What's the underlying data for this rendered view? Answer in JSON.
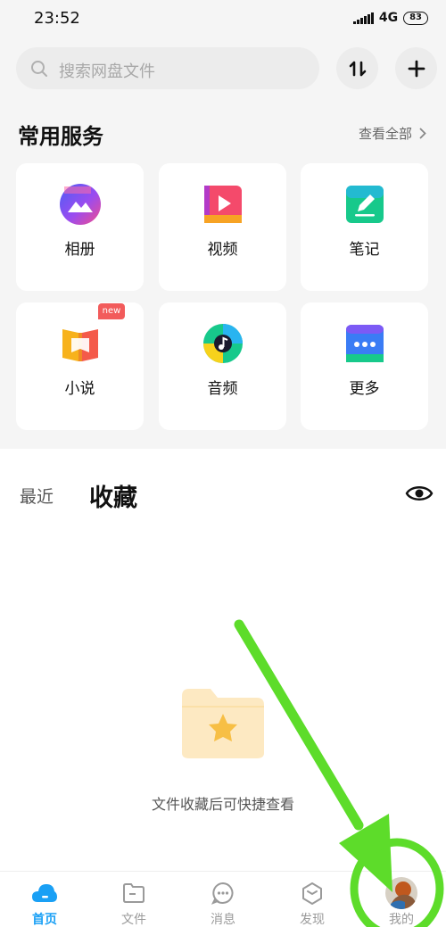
{
  "status_bar": {
    "time": "23:52",
    "network": "4G",
    "battery": "83"
  },
  "search": {
    "placeholder": "搜索网盘文件"
  },
  "services": {
    "title": "常用服务",
    "view_all": "查看全部",
    "items": [
      {
        "label": "相册",
        "icon": "photo-album-icon"
      },
      {
        "label": "视频",
        "icon": "video-icon"
      },
      {
        "label": "笔记",
        "icon": "note-icon"
      },
      {
        "label": "小说",
        "icon": "novel-icon",
        "badge": "new"
      },
      {
        "label": "音频",
        "icon": "audio-icon"
      },
      {
        "label": "更多",
        "icon": "more-icon"
      }
    ]
  },
  "tabs": {
    "recent": "最近",
    "favorites": "收藏"
  },
  "empty_state": {
    "text": "文件收藏后可快捷查看"
  },
  "bottom_nav": {
    "items": [
      {
        "label": "首页",
        "icon": "home-cloud-icon",
        "active": true
      },
      {
        "label": "文件",
        "icon": "folder-icon"
      },
      {
        "label": "消息",
        "icon": "message-icon"
      },
      {
        "label": "发现",
        "icon": "discover-icon"
      },
      {
        "label": "我的",
        "icon": "avatar"
      }
    ]
  },
  "colors": {
    "accent": "#1aa0f5",
    "badge": "#f25b5b",
    "annotation": "#5ddc2a",
    "background": "#f5f5f5"
  }
}
